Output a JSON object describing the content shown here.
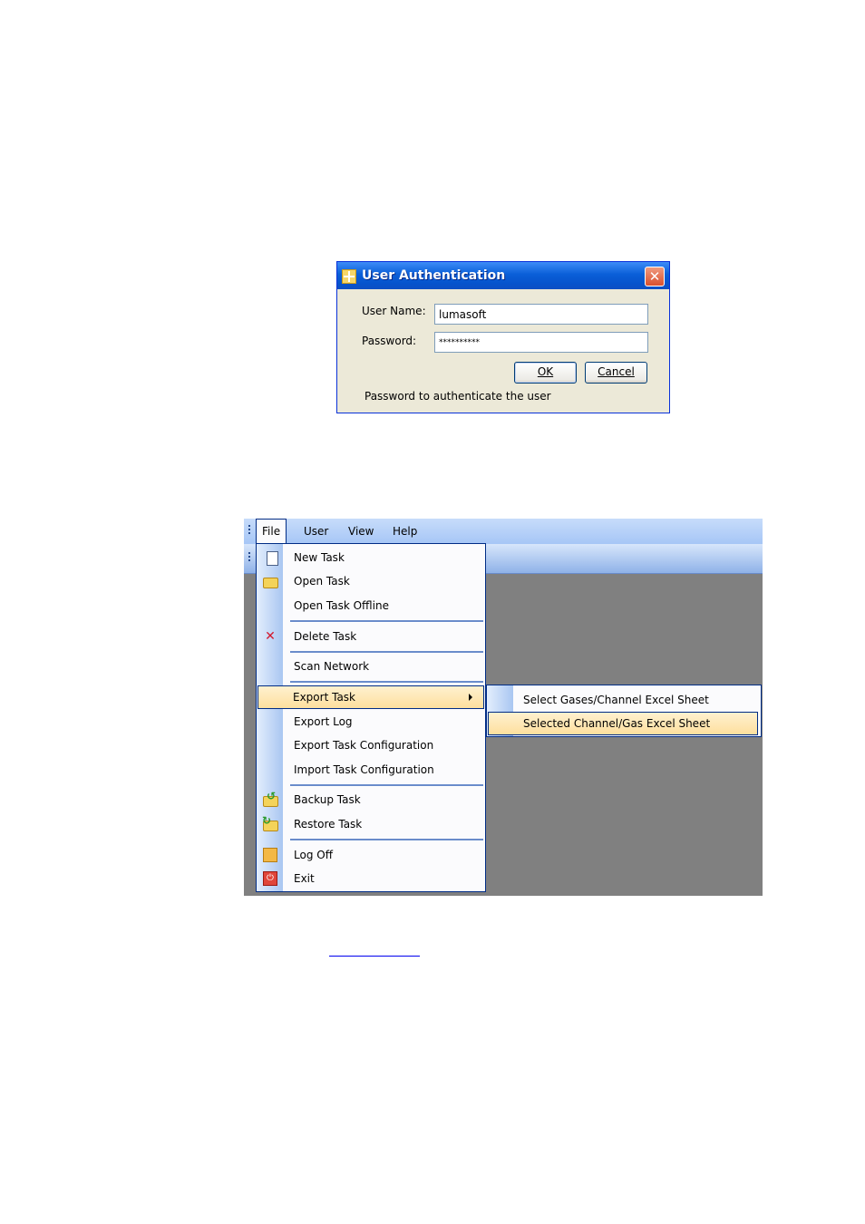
{
  "dialog": {
    "title": "User Authentication",
    "close_label": "✕",
    "username_label": "User Name:",
    "username_value": "lumasoft",
    "password_label": "Password:",
    "password_value": "**********",
    "ok_label": "OK",
    "cancel_label": "Cancel",
    "status": "Password to authenticate the user"
  },
  "menubar": {
    "items": [
      {
        "label": "File"
      },
      {
        "label": "User"
      },
      {
        "label": "View"
      },
      {
        "label": "Help"
      }
    ]
  },
  "file_menu": {
    "items": [
      {
        "label": "New Task",
        "icon": "new-page-icon"
      },
      {
        "label": "Open Task",
        "icon": "folder-icon"
      },
      {
        "label": "Open Task Offline"
      },
      {
        "label": "Delete Task",
        "icon": "delete-icon"
      },
      {
        "label": "Scan Network"
      },
      {
        "label": "Export Task"
      },
      {
        "label": "Export Log"
      },
      {
        "label": "Export Task Configuration"
      },
      {
        "label": "Import Task Configuration"
      },
      {
        "label": "Backup Task",
        "icon": "backup-icon"
      },
      {
        "label": "Restore Task",
        "icon": "restore-icon"
      },
      {
        "label": "Log Off",
        "icon": "key-icon"
      },
      {
        "label": "Exit",
        "icon": "exit-icon"
      }
    ]
  },
  "export_submenu": {
    "items": [
      {
        "label": "Select Gases/Channel Excel Sheet"
      },
      {
        "label": "Selected Channel/Gas Excel Sheet"
      }
    ]
  }
}
